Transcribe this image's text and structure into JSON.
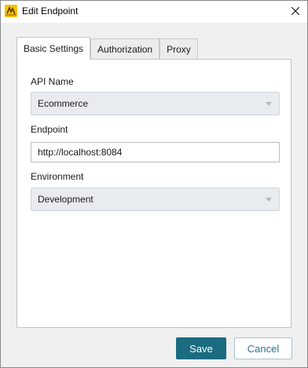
{
  "window": {
    "title": "Edit Endpoint",
    "icon": "app-logo-icon",
    "close_icon": "close-icon"
  },
  "tabs": [
    {
      "label": "Basic Settings",
      "active": true
    },
    {
      "label": "Authorization",
      "active": false
    },
    {
      "label": "Proxy",
      "active": false
    }
  ],
  "form": {
    "api_name": {
      "label": "API Name",
      "value": "Ecommerce"
    },
    "endpoint": {
      "label": "Endpoint",
      "value": "http://localhost:8084"
    },
    "environment": {
      "label": "Environment",
      "value": "Development"
    }
  },
  "buttons": {
    "save_label": "Save",
    "cancel_label": "Cancel"
  },
  "colors": {
    "accent": "#1b6c80",
    "cancel_text": "#2a7690",
    "panel_bg": "#ffffff",
    "window_bg": "#f0f0f0"
  }
}
